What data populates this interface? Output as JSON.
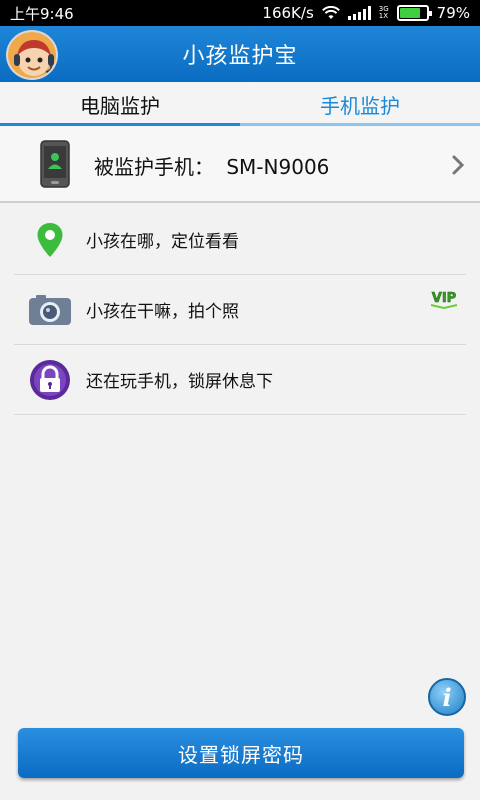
{
  "status_bar": {
    "time": "上午9:46",
    "net_speed": "166K/s",
    "network_type_top": "3G",
    "network_type_bottom": "1X",
    "battery_percent": "79%",
    "battery_level": 0.79
  },
  "header": {
    "title": "小孩监护宝",
    "avatar_icon": "cartoon-child-icon"
  },
  "tabs": [
    {
      "label": "电脑监护",
      "active": false
    },
    {
      "label": "手机监护",
      "active": true
    }
  ],
  "device": {
    "label": "被监护手机：",
    "model": "SM-N9006"
  },
  "menu": {
    "items": [
      {
        "label": "小孩在哪，定位看看",
        "icon": "location-pin-icon"
      },
      {
        "label": "小孩在干嘛，拍个照",
        "icon": "camera-icon",
        "badge": "VIP"
      },
      {
        "label": "还在玩手机，锁屏休息下",
        "icon": "lock-icon"
      }
    ]
  },
  "info_button_icon": "info-icon",
  "primary_action": {
    "label": "设置锁屏密码"
  },
  "colors": {
    "accent": "#1a8ad8",
    "header": "#0a6cc0",
    "location_green": "#3dbb3d",
    "vip_green": "#3a9a2a",
    "lock_purple": "#5a2a9a"
  }
}
